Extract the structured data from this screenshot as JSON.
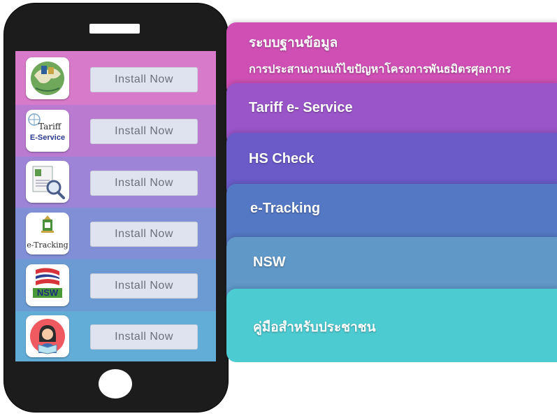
{
  "phone": {
    "install_label": "Install  Now",
    "apps": [
      {
        "icon": "customs-database-icon",
        "bg": "#d86ec6"
      },
      {
        "icon": "tariff-eservice-icon",
        "bg": "#b775d1",
        "icon_text_1": "Tariff",
        "icon_text_2": "E-Service"
      },
      {
        "icon": "hs-check-icon",
        "bg": "#9d7dd3"
      },
      {
        "icon": "e-tracking-icon",
        "bg": "#7e86d2",
        "icon_text": "e-Tracking"
      },
      {
        "icon": "nsw-icon",
        "bg": "#6c93cf",
        "icon_text": "NSW"
      },
      {
        "icon": "public-handbook-icon",
        "bg": "#62a8d6"
      }
    ]
  },
  "menu": {
    "items": [
      {
        "title": "ระบบฐานข้อมูล",
        "subtitle": "การประสานงานแก้ไขปัญหาโครงการพันธมิตรศุลกากร",
        "color": "#cf4fb5"
      },
      {
        "title": "Tariff e- Service",
        "color": "#9a55c9"
      },
      {
        "title": "HS Check",
        "color": "#6b5bc9"
      },
      {
        "title": "e-Tracking",
        "color": "#5578c4"
      },
      {
        "title": "NSW",
        "color": "#6098c8"
      },
      {
        "title": "คู่มือสำหรับประชาชน",
        "color": "#4ccbd1"
      }
    ]
  }
}
